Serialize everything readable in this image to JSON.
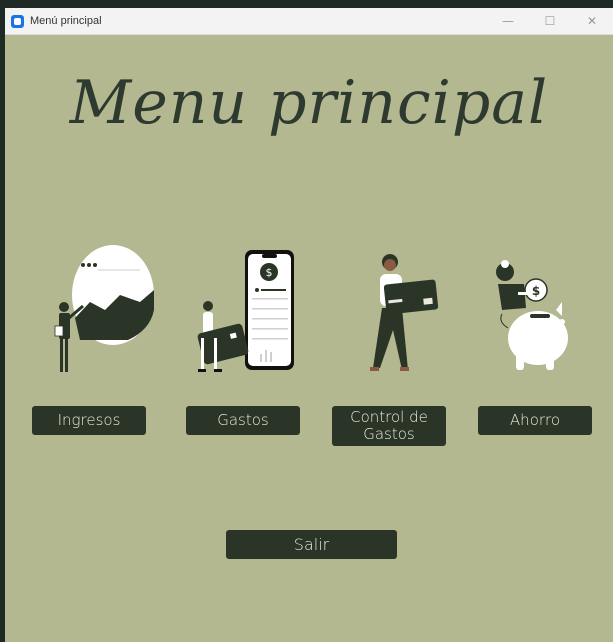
{
  "window": {
    "title": "Menú principal",
    "controls": {
      "minimize": "—",
      "maximize": "☐",
      "close": "✕"
    }
  },
  "heading": "Menu principal",
  "buttons": {
    "ingresos": "Ingresos",
    "gastos": "Gastos",
    "control_line1": "Control de",
    "control_line2": "Gastos",
    "ahorro": "Ahorro",
    "salir": "Salir"
  },
  "icons": {
    "ingresos": "person-with-chart-illustration",
    "gastos": "person-with-card-and-phone-illustration",
    "control": "person-carrying-card-illustration",
    "ahorro": "person-with-piggy-bank-illustration"
  },
  "colors": {
    "background": "#b3b891",
    "button": "#2b3527",
    "button_text": "#e7eadc",
    "heading": "#2e3a30"
  }
}
